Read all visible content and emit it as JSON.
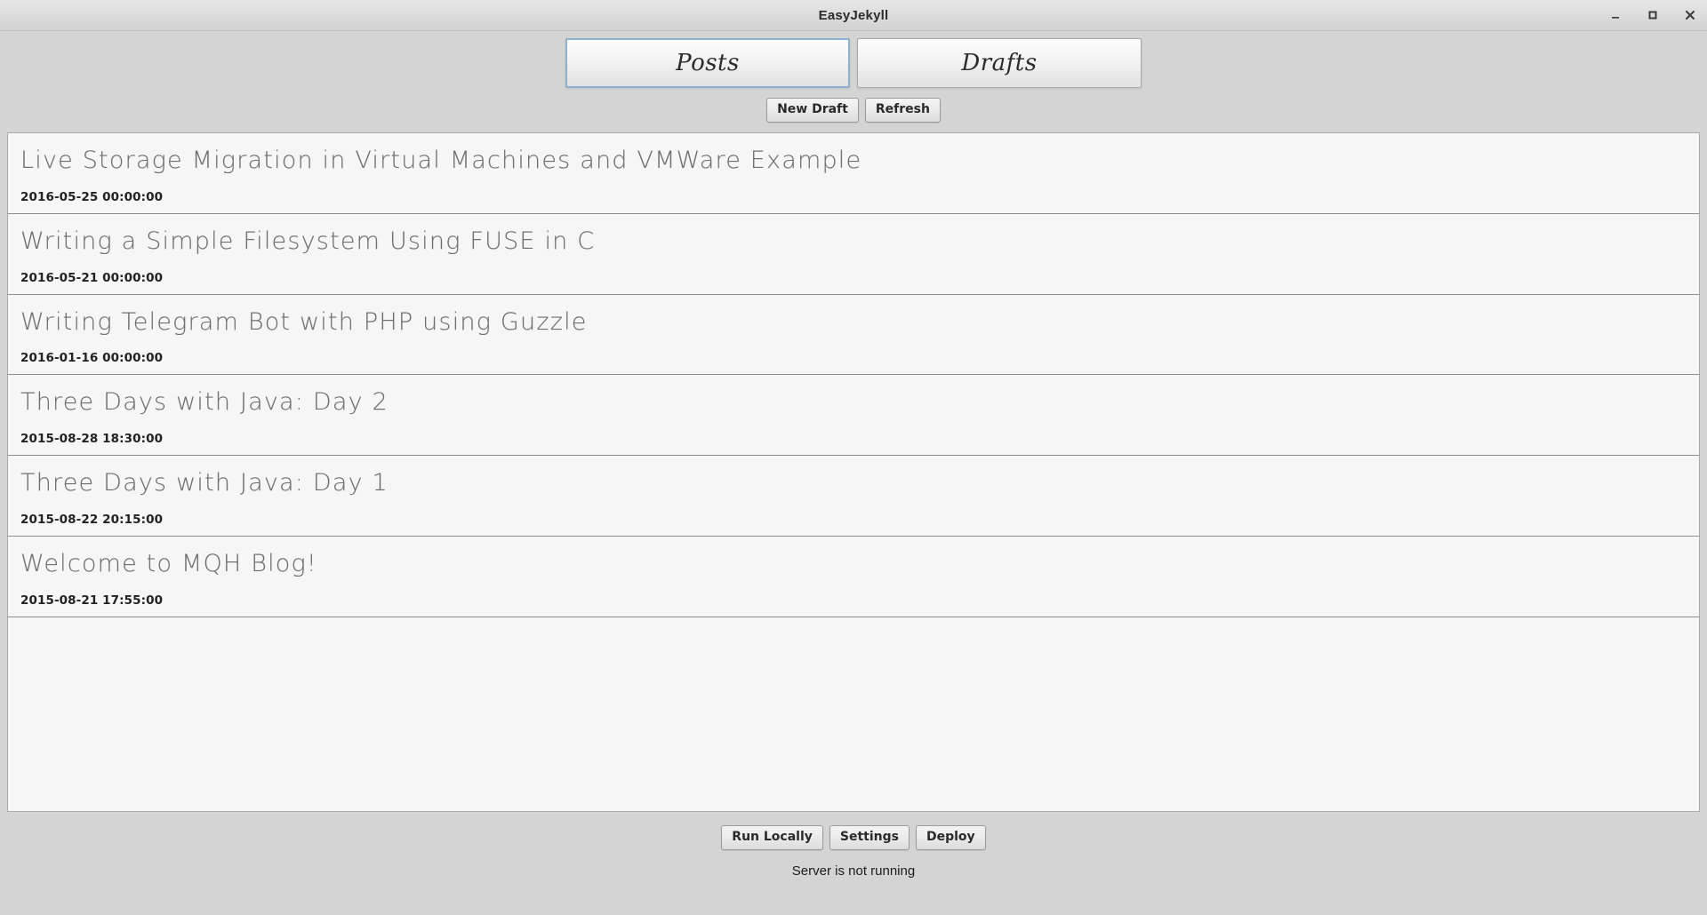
{
  "window": {
    "title": "EasyJekyll",
    "controls": {
      "minimize": "minimize-icon",
      "maximize": "maximize-icon",
      "close": "close-icon"
    }
  },
  "tabs": [
    {
      "label": "Posts",
      "active": true
    },
    {
      "label": "Drafts",
      "active": false
    }
  ],
  "toolbar": {
    "new_draft_label": "New Draft",
    "refresh_label": "Refresh"
  },
  "posts": [
    {
      "title": "Live Storage Migration in Virtual Machines and VMWare Example",
      "date": "2016-05-25 00:00:00"
    },
    {
      "title": "Writing a Simple Filesystem Using FUSE in C",
      "date": "2016-05-21 00:00:00"
    },
    {
      "title": "Writing Telegram Bot with PHP using Guzzle",
      "date": "2016-01-16 00:00:00"
    },
    {
      "title": "Three Days with Java: Day 2",
      "date": "2015-08-28 18:30:00"
    },
    {
      "title": "Three Days with Java: Day 1",
      "date": "2015-08-22 20:15:00"
    },
    {
      "title": "Welcome to MQH Blog!",
      "date": "2015-08-21 17:55:00"
    }
  ],
  "footer": {
    "run_locally_label": "Run Locally",
    "settings_label": "Settings",
    "deploy_label": "Deploy",
    "status": "Server is not running"
  },
  "colors": {
    "page_background": "#d4d4d4",
    "list_background": "#f6f6f6",
    "active_tab_border": "#8fb0d0",
    "inactive_tab_border": "#a8a8a8",
    "title_text": "#6f6f6f"
  }
}
